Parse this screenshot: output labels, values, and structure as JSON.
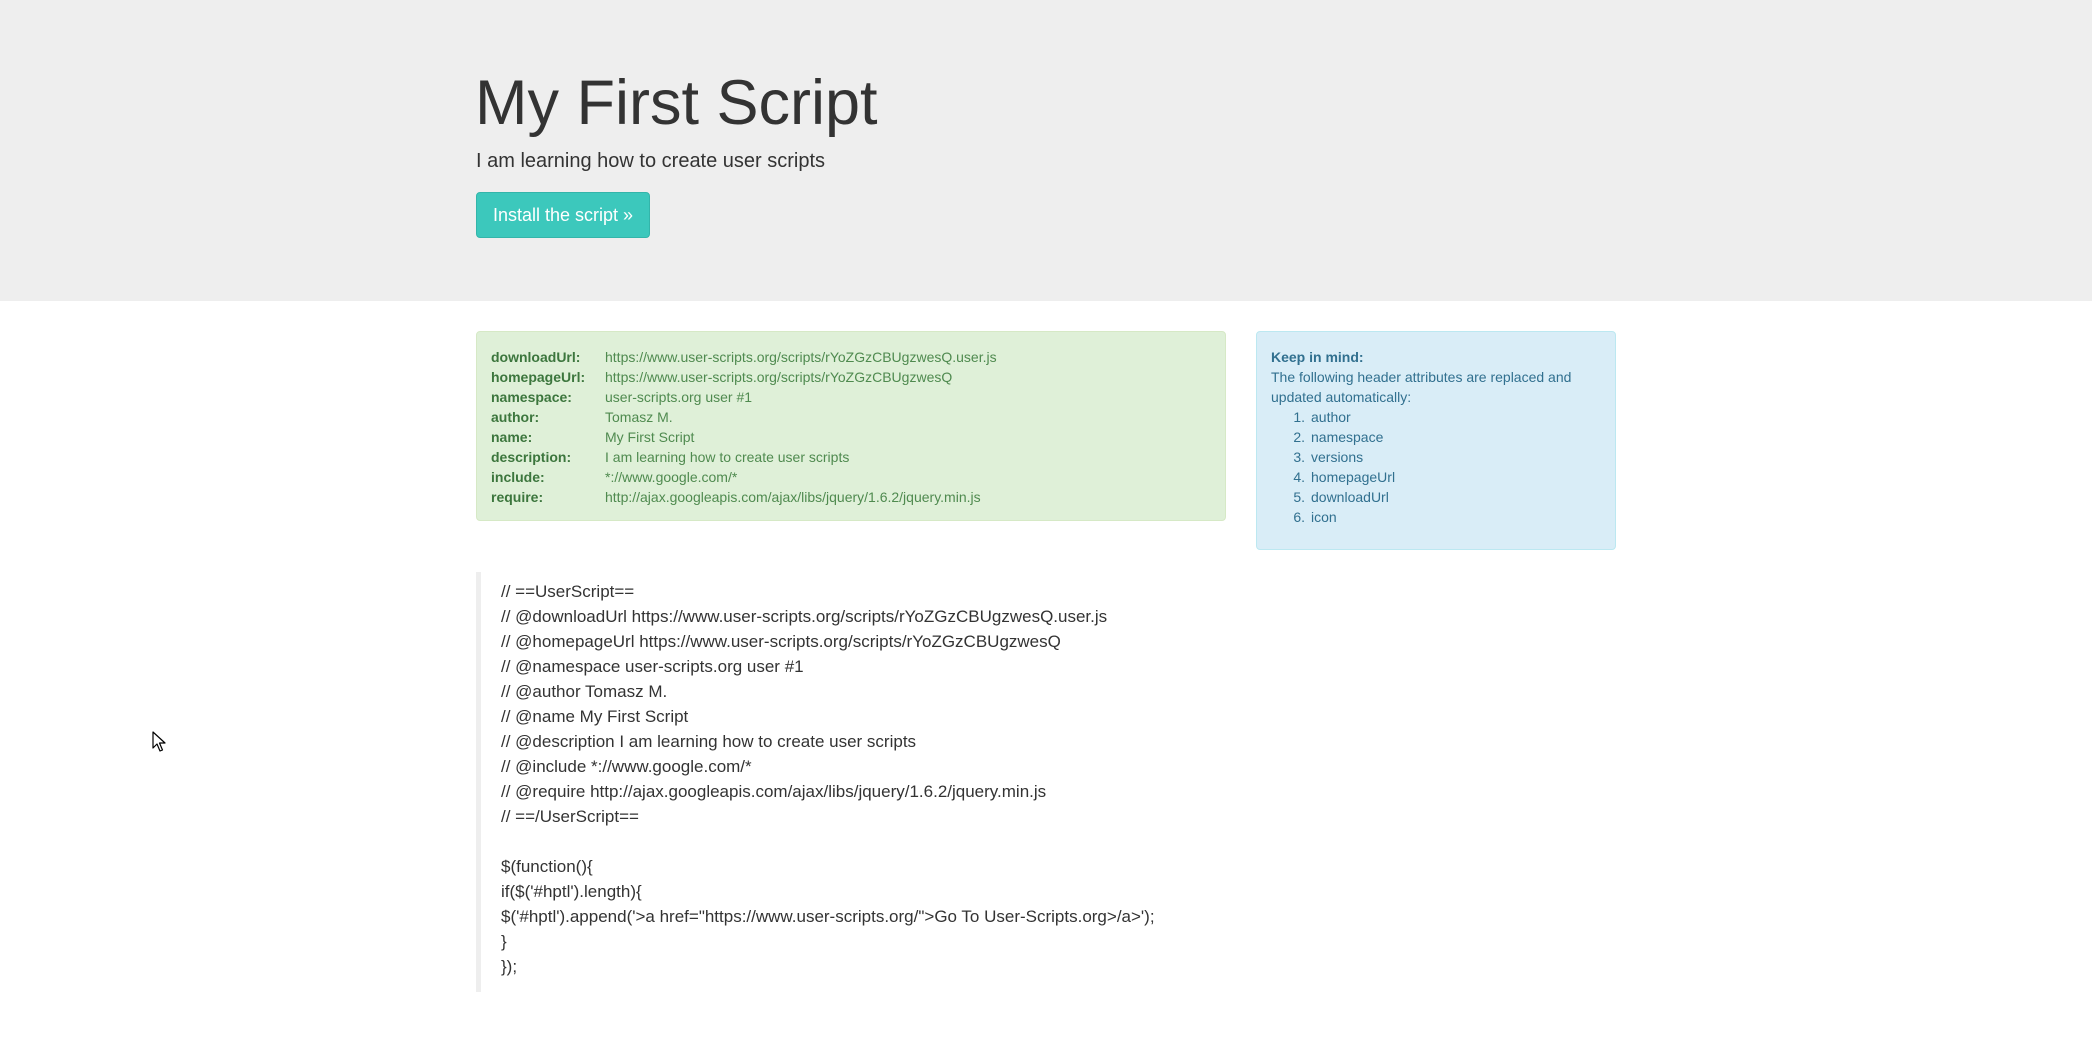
{
  "jumbotron": {
    "title": "My First Script",
    "subtitle": "I am learning how to create user scripts",
    "install_button": "Install the script »"
  },
  "meta": [
    {
      "key": "downloadUrl:",
      "value": "https://www.user-scripts.org/scripts/rYoZGzCBUgzwesQ.user.js"
    },
    {
      "key": "homepageUrl:",
      "value": "https://www.user-scripts.org/scripts/rYoZGzCBUgzwesQ"
    },
    {
      "key": "namespace:",
      "value": "user-scripts.org user #1"
    },
    {
      "key": "author:",
      "value": "Tomasz M."
    },
    {
      "key": "name:",
      "value": "My First Script"
    },
    {
      "key": "description:",
      "value": "I am learning how to create user scripts"
    },
    {
      "key": "include:",
      "value": "*://www.google.com/*"
    },
    {
      "key": "require:",
      "value": "http://ajax.googleapis.com/ajax/libs/jquery/1.6.2/jquery.min.js"
    }
  ],
  "info": {
    "title": "Keep in mind:",
    "text": "The following header attributes are replaced and updated automatically:",
    "items": [
      {
        "num": "1.",
        "label": "author"
      },
      {
        "num": "2.",
        "label": "namespace"
      },
      {
        "num": "3.",
        "label": "versions"
      },
      {
        "num": "4.",
        "label": "homepageUrl"
      },
      {
        "num": "5.",
        "label": "downloadUrl"
      },
      {
        "num": "6.",
        "label": "icon"
      }
    ]
  },
  "code": [
    "// ==UserScript==",
    "// @downloadUrl https://www.user-scripts.org/scripts/rYoZGzCBUgzwesQ.user.js",
    "// @homepageUrl https://www.user-scripts.org/scripts/rYoZGzCBUgzwesQ",
    "// @namespace user-scripts.org user #1",
    "// @author Tomasz M.",
    "// @name My First Script",
    "// @description I am learning how to create user scripts",
    "// @include *://www.google.com/*",
    "// @require http://ajax.googleapis.com/ajax/libs/jquery/1.6.2/jquery.min.js",
    "// ==/UserScript==",
    "",
    "$(function(){",
    "if($('#hptl').length){",
    "$('#hptl').append('>a href=\"https://www.user-scripts.org/\">Go To User-Scripts.org>/a>');",
    "}",
    "});"
  ],
  "colors": {
    "jumbotron_bg": "#eeeeee",
    "button_bg": "#3cc8bc",
    "success_bg": "#dff0d8",
    "success_text": "#3c763d",
    "info_bg": "#d9edf7",
    "info_text": "#31708f"
  },
  "icons": {
    "cursor": "mouse-pointer-icon"
  }
}
